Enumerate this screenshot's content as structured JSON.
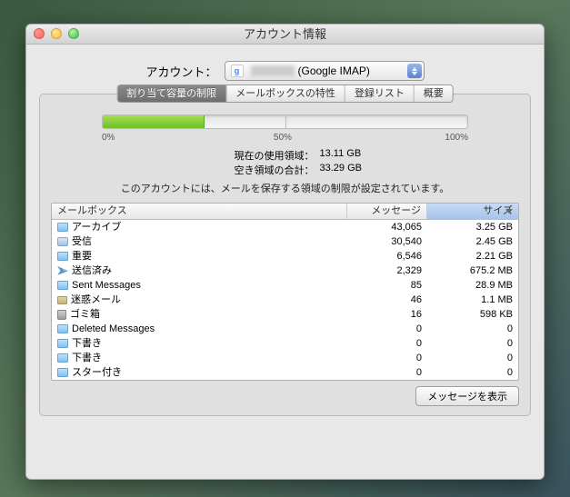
{
  "window_title": "アカウント情報",
  "account": {
    "label": "アカウント：",
    "provider_letter": "g",
    "provider_suffix": "(Google IMAP)"
  },
  "tabs": {
    "quota": "割り当て容量の制限",
    "properties": "メールボックスの特性",
    "subscriptions": "登録リスト",
    "summary": "概要"
  },
  "scale": {
    "p0": "0%",
    "p50": "50%",
    "p100": "100%"
  },
  "progress_percent": 28,
  "info": {
    "used_label": "現在の使用領域：",
    "used_value": "13.11 GB",
    "free_label": "空き領域の合計：",
    "free_value": "33.29 GB"
  },
  "note": "このアカウントには、メールを保存する領域の制限が設定されています。",
  "columns": {
    "mailbox": "メールボックス",
    "messages": "メッセージ",
    "size": "サイズ"
  },
  "rows": [
    {
      "icon": "folder",
      "name": "アーカイブ",
      "messages": "43,065",
      "size": "3.25 GB"
    },
    {
      "icon": "inbox",
      "name": "受信",
      "messages": "30,540",
      "size": "2.45 GB"
    },
    {
      "icon": "folder",
      "name": "重要",
      "messages": "6,546",
      "size": "2.21 GB"
    },
    {
      "icon": "send",
      "name": "送信済み",
      "messages": "2,329",
      "size": "675.2 MB"
    },
    {
      "icon": "folder",
      "name": "Sent Messages",
      "messages": "85",
      "size": "28.9 MB"
    },
    {
      "icon": "junk",
      "name": "迷惑メール",
      "messages": "46",
      "size": "1.1 MB"
    },
    {
      "icon": "trash",
      "name": "ゴミ箱",
      "messages": "16",
      "size": "598 KB"
    },
    {
      "icon": "folder",
      "name": "Deleted Messages",
      "messages": "0",
      "size": "0"
    },
    {
      "icon": "folder",
      "name": "下書き",
      "messages": "0",
      "size": "0"
    },
    {
      "icon": "folder",
      "name": "下書き",
      "messages": "0",
      "size": "0"
    },
    {
      "icon": "folder",
      "name": "スター付き",
      "messages": "0",
      "size": "0"
    }
  ],
  "show_messages_button": "メッセージを表示"
}
